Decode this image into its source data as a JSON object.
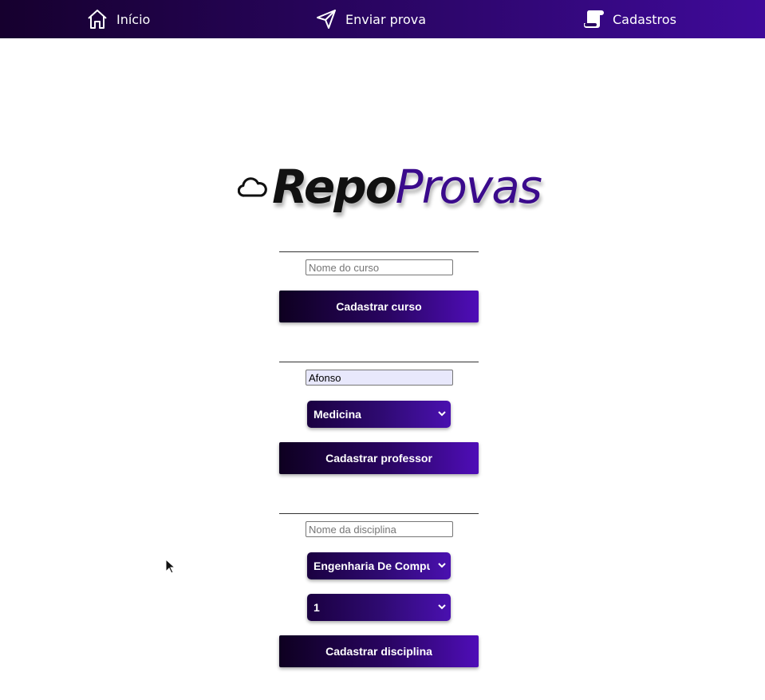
{
  "nav": {
    "home": {
      "label": "Início",
      "icon": "home-icon"
    },
    "send": {
      "label": "Enviar prova",
      "icon": "paper-plane-icon"
    },
    "register": {
      "label": "Cadastros",
      "icon": "scroll-icon"
    }
  },
  "logo": {
    "icon": "cloud-icon",
    "part1": "Repo",
    "part2": "Provas"
  },
  "course_form": {
    "name_placeholder": "Nome do curso",
    "name_value": "",
    "submit_label": "Cadastrar curso"
  },
  "professor_form": {
    "name_placeholder": "",
    "name_value": "Afonso",
    "course_selected": "Medicina",
    "submit_label": "Cadastrar professor"
  },
  "discipline_form": {
    "name_placeholder": "Nome da disciplina",
    "name_value": "",
    "course_selected": "Engenharia De Computação",
    "semester_selected": "1",
    "submit_label": "Cadastrar disciplina"
  },
  "colors": {
    "accent_dark": "#16002e",
    "accent_light": "#4f0db8",
    "logo_purple": "#3a0a8c"
  }
}
